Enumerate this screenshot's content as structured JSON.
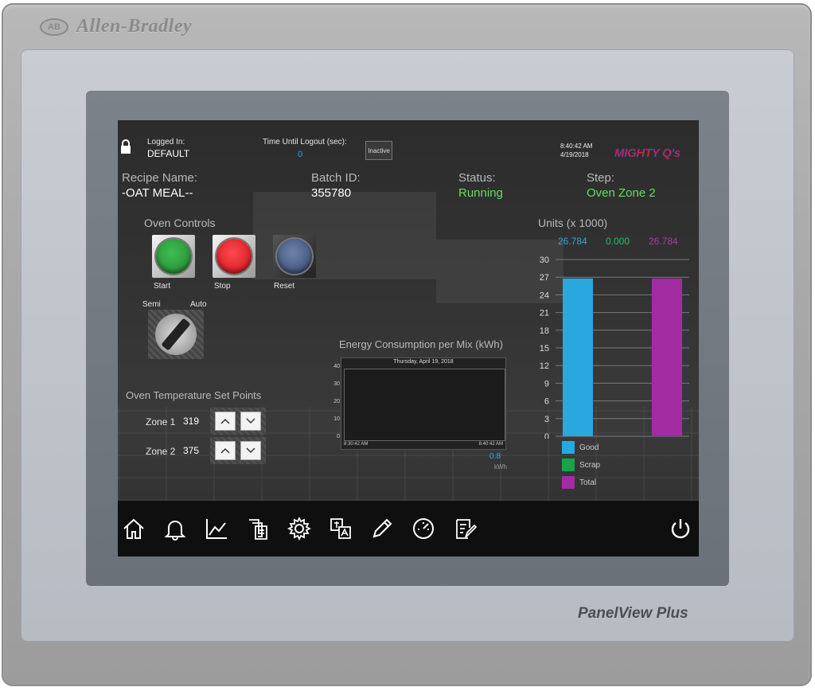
{
  "brand": {
    "name": "Allen-Bradley",
    "logo": "AB",
    "model": "PanelView Plus"
  },
  "header": {
    "logged_in_label": "Logged In:",
    "user": "DEFAULT",
    "logout_label": "Time Until Logout (sec):",
    "logout_value": "0",
    "inactive_button": "Inactive",
    "time": "8:40:42 AM",
    "date": "4/19/2018",
    "company_logo_text": "MIGHTY Q's"
  },
  "status_row": {
    "recipe_label": "Recipe Name:",
    "recipe_value": "-OAT MEAL--",
    "batch_label": "Batch ID:",
    "batch_value": "355780",
    "status_label": "Status:",
    "status_value": "Running",
    "step_label": "Step:",
    "step_value": "Oven Zone 2"
  },
  "oven_controls": {
    "title": "Oven Controls",
    "buttons": [
      {
        "label": "Start",
        "color": "#2e9b3e"
      },
      {
        "label": "Stop",
        "color": "#e0262c"
      },
      {
        "label": "Reset",
        "color": "#4a5e85"
      }
    ],
    "selector_left": "Semi",
    "selector_right": "Auto"
  },
  "setpoints": {
    "title": "Oven Temperature Set Points",
    "zones": [
      {
        "label": "Zone 1",
        "value": "319"
      },
      {
        "label": "Zone 2",
        "value": "375"
      }
    ]
  },
  "energy": {
    "title": "Energy Consumption per Mix (kWh)",
    "date": "Thursday, April 19, 2018",
    "y_ticks": [
      "40",
      "30",
      "20",
      "10",
      "0"
    ],
    "x_start": "8:30:42 AM",
    "x_end": "8:40:42 AM",
    "current": "0.8",
    "unit": "kWh"
  },
  "units": {
    "title": "Units (x 1000)",
    "values": [
      {
        "text": "26.784",
        "color": "#29a8e0"
      },
      {
        "text": "0.000",
        "color": "#20c05a"
      },
      {
        "text": "26.784",
        "color": "#a53ca8"
      }
    ]
  },
  "chart_data": {
    "type": "bar",
    "categories": [
      "Good",
      "Scrap",
      "Total"
    ],
    "values": [
      26.784,
      0,
      26.784
    ],
    "colors": [
      "#29a8e0",
      "#17a34a",
      "#a32ca3"
    ],
    "ylim": [
      0,
      30
    ],
    "y_ticks": [
      "30",
      "27",
      "24",
      "21",
      "18",
      "15",
      "12",
      "9",
      "6",
      "3",
      "0"
    ],
    "legend": [
      "Good",
      "Scrap",
      "Total"
    ],
    "grid": true
  },
  "nav": {
    "icons": [
      "home-icon",
      "bell-icon",
      "trend-icon",
      "reports-icon",
      "settings-icon",
      "language-icon",
      "edit-icon",
      "gauge-icon",
      "notes-icon",
      "power-icon"
    ]
  }
}
